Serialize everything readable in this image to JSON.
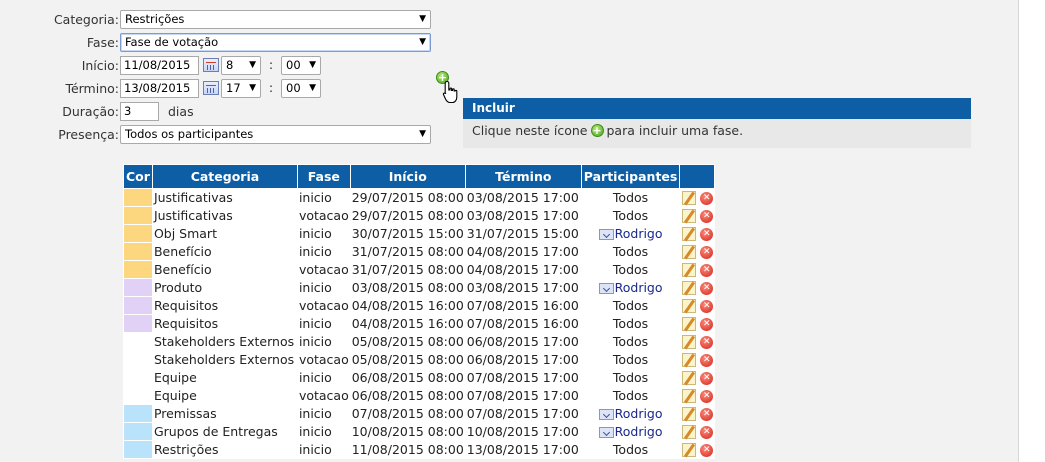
{
  "form": {
    "categoria_label": "Categoria:",
    "categoria_value": "Restrições",
    "fase_label": "Fase:",
    "fase_value": "Fase de votação",
    "inicio_label": "Início:",
    "inicio_date": "11/08/2015",
    "inicio_hour": "8",
    "inicio_minute": "00",
    "termino_label": "Término:",
    "termino_date": "13/08/2015",
    "termino_hour": "17",
    "termino_minute": "00",
    "time_separator": ":",
    "duracao_label": "Duração:",
    "duracao_value": "3",
    "duracao_unit": "dias",
    "presenca_label": "Presença:",
    "presenca_value": "Todos os participantes"
  },
  "icons": {
    "add": "plus-circle-icon",
    "cursor": "hand-pointer-icon",
    "calendar": "calendar-icon",
    "edit": "pencil-icon",
    "delete": "delete-x-icon",
    "expand": "chevron-down-icon"
  },
  "info": {
    "title": "Incluir",
    "text_before": "Clique neste ícone",
    "text_after": "para incluir uma fase."
  },
  "table": {
    "headers": [
      "Cor",
      "Categoria",
      "Fase",
      "Início",
      "Término",
      "Participantes",
      ""
    ],
    "rows": [
      {
        "color": "#fdd77f",
        "categoria": "Justificativas",
        "fase": "inicio",
        "inicio": "29/07/2015 08:00",
        "termino": "03/08/2015 17:00",
        "participantes": "Todos",
        "expand": false
      },
      {
        "color": "#fdd77f",
        "categoria": "Justificativas",
        "fase": "votacao",
        "inicio": "29/07/2015 08:00",
        "termino": "03/08/2015 17:00",
        "participantes": "Todos",
        "expand": false
      },
      {
        "color": "#fdd77f",
        "categoria": "Obj Smart",
        "fase": "inicio",
        "inicio": "30/07/2015 15:00",
        "termino": "31/07/2015 15:00",
        "participantes": "Rodrigo",
        "expand": true
      },
      {
        "color": "#fdd77f",
        "categoria": "Benefício",
        "fase": "inicio",
        "inicio": "31/07/2015 08:00",
        "termino": "04/08/2015 17:00",
        "participantes": "Todos",
        "expand": false
      },
      {
        "color": "#fdd77f",
        "categoria": "Benefício",
        "fase": "votacao",
        "inicio": "31/07/2015 08:00",
        "termino": "04/08/2015 17:00",
        "participantes": "Todos",
        "expand": false
      },
      {
        "color": "#e2d1f7",
        "categoria": "Produto",
        "fase": "inicio",
        "inicio": "03/08/2015 08:00",
        "termino": "03/08/2015 17:00",
        "participantes": "Rodrigo",
        "expand": true
      },
      {
        "color": "#e2d1f7",
        "categoria": "Requisitos",
        "fase": "votacao",
        "inicio": "04/08/2015 16:00",
        "termino": "07/08/2015 16:00",
        "participantes": "Todos",
        "expand": false
      },
      {
        "color": "#e2d1f7",
        "categoria": "Requisitos",
        "fase": "inicio",
        "inicio": "04/08/2015 16:00",
        "termino": "07/08/2015 16:00",
        "participantes": "Todos",
        "expand": false
      },
      {
        "color": "#ffffff",
        "categoria": "Stakeholders Externos",
        "fase": "inicio",
        "inicio": "05/08/2015 08:00",
        "termino": "06/08/2015 17:00",
        "participantes": "Todos",
        "expand": false
      },
      {
        "color": "#ffffff",
        "categoria": "Stakeholders Externos",
        "fase": "votacao",
        "inicio": "05/08/2015 08:00",
        "termino": "06/08/2015 17:00",
        "participantes": "Todos",
        "expand": false
      },
      {
        "color": "#ffffff",
        "categoria": "Equipe",
        "fase": "inicio",
        "inicio": "06/08/2015 08:00",
        "termino": "07/08/2015 17:00",
        "participantes": "Todos",
        "expand": false
      },
      {
        "color": "#ffffff",
        "categoria": "Equipe",
        "fase": "votacao",
        "inicio": "06/08/2015 08:00",
        "termino": "07/08/2015 17:00",
        "participantes": "Todos",
        "expand": false
      },
      {
        "color": "#b8e3fb",
        "categoria": "Premissas",
        "fase": "inicio",
        "inicio": "07/08/2015 08:00",
        "termino": "07/08/2015 17:00",
        "participantes": "Rodrigo",
        "expand": true
      },
      {
        "color": "#b8e3fb",
        "categoria": "Grupos de Entregas",
        "fase": "inicio",
        "inicio": "10/08/2015 08:00",
        "termino": "10/08/2015 17:00",
        "participantes": "Rodrigo",
        "expand": true
      },
      {
        "color": "#b8e3fb",
        "categoria": "Restrições",
        "fase": "inicio",
        "inicio": "11/08/2015 08:00",
        "termino": "13/08/2015 17:00",
        "participantes": "Todos",
        "expand": false
      }
    ]
  }
}
